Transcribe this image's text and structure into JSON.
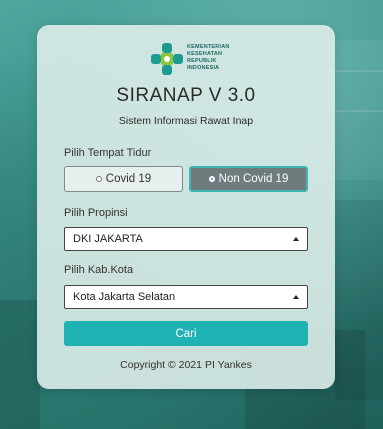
{
  "logo": {
    "lines": [
      "KEMENTERIAN",
      "KESEHATAN",
      "REPUBLIK",
      "INDONESIA"
    ],
    "icon": "kemenkes-logo-icon"
  },
  "header": {
    "title": "SIRANAP V 3.0",
    "subtitle": "Sistem Informasi Rawat Inap"
  },
  "bed_type": {
    "label": "Pilih Tempat Tidur",
    "options": [
      {
        "label": "Covid 19",
        "selected": false
      },
      {
        "label": "Non Covid 19",
        "selected": true
      }
    ]
  },
  "province": {
    "label": "Pilih Propinsi",
    "value": "DKI JAKARTA"
  },
  "city": {
    "label": "Pilih Kab.Kota",
    "value": "Kota Jakarta Selatan"
  },
  "search_button": {
    "label": "Cari"
  },
  "footer": {
    "copyright": "Copyright © 2021 PI Yankes"
  },
  "colors": {
    "accent": "#1fb2b3",
    "selected_option_bg": "#6f7c7d",
    "selected_option_border": "#3fb6b6",
    "logo_green": "#8cc63f",
    "logo_teal": "#1e9b8f"
  }
}
